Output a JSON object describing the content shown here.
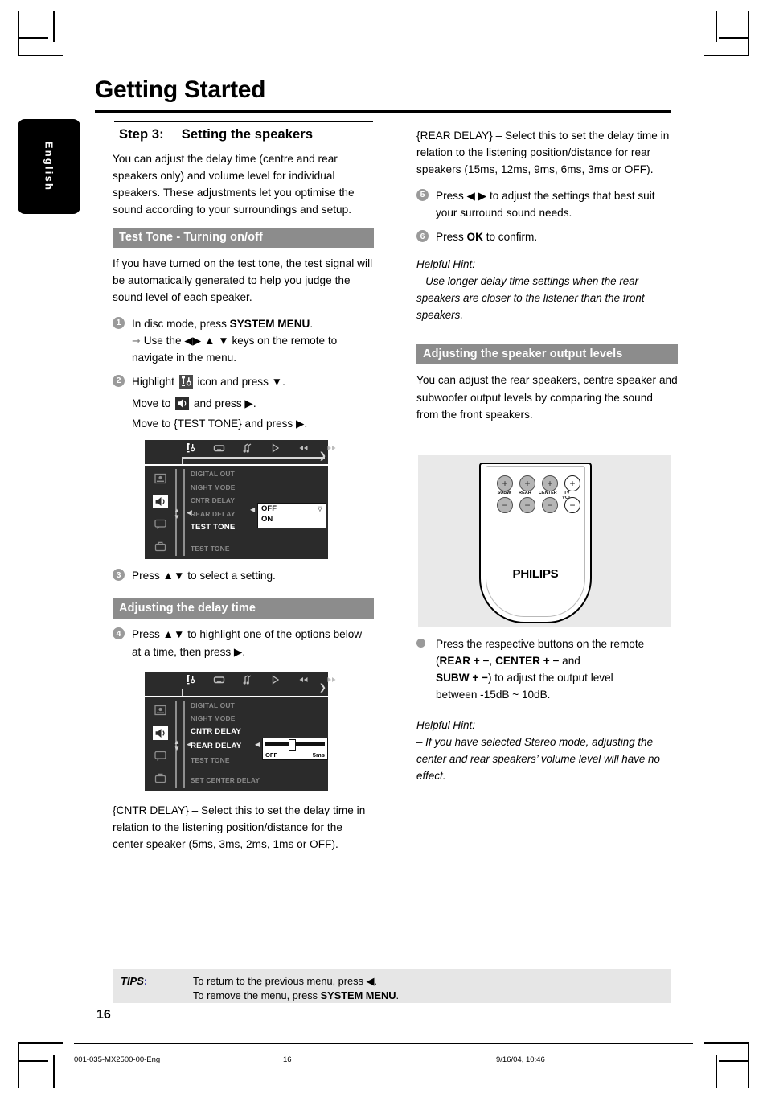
{
  "document": {
    "title": "Getting Started",
    "language_tab": "English",
    "page_number": "16"
  },
  "left_column": {
    "step_heading": {
      "prefix": "Step 3:",
      "text": "Setting the speakers"
    },
    "intro": "You can adjust the delay time (centre and rear speakers only) and volume level for individual speakers. These adjustments let you optimise the sound according to your surroundings and setup.",
    "section_test_tone": {
      "bar_label": "Test Tone - Turning on/off",
      "paragraph": "If you have turned on the test tone, the test signal will be automatically generated to help you judge the sound level of each speaker.",
      "steps": [
        {
          "number": "1",
          "line1_pre": "In disc mode, press ",
          "line1_bold": "SYSTEM MENU",
          "line1_post": ".",
          "arrow_line": "Use the ◀▶ ▲ ▼ keys on the remote to navigate in the menu."
        },
        {
          "number": "2",
          "line_a_pre": "Highlight ",
          "line_a_post": " icon and press ▼.",
          "line_b_pre": "Move to ",
          "line_b_post": " and press ▶.",
          "line_c": "Move to {TEST TONE} and press ▶."
        },
        {
          "number": "3",
          "text": "Press ▲▼ to select a setting."
        }
      ]
    },
    "osd_test_tone": {
      "top_icons": [
        "tools-icon",
        "display-icon",
        "audio-icon",
        "play-icon",
        "rewind-icon",
        "forward-icon"
      ],
      "side_icons": [
        "picture-icon",
        "speaker-icon",
        "subtitle-icon",
        "briefcase-icon"
      ],
      "menu_items": [
        "DIGITAL OUT",
        "NIGHT MODE",
        "CNTR DELAY",
        "REAR DELAY",
        "TEST TONE"
      ],
      "active_item": "TEST TONE",
      "footer_hint": "TEST TONE",
      "dropdown_options": [
        "OFF",
        "ON"
      ]
    },
    "section_delay": {
      "bar_label": "Adjusting the delay time",
      "step": {
        "number": "4",
        "text": "Press ▲▼ to highlight one of the options below at a time, then press ▶."
      }
    },
    "osd_delay": {
      "top_icons": [
        "tools-icon",
        "display-icon",
        "audio-icon",
        "play-icon",
        "rewind-icon",
        "forward-icon"
      ],
      "side_icons": [
        "picture-icon",
        "speaker-icon",
        "subtitle-icon",
        "briefcase-icon"
      ],
      "menu_items": [
        "DIGITAL OUT",
        "NIGHT MODE",
        "CNTR DELAY",
        "REAR DELAY",
        "TEST TONE"
      ],
      "active_items": [
        "CNTR DELAY",
        "REAR DELAY"
      ],
      "footer_hint": "SET CENTER DELAY",
      "slider_min_label": "OFF",
      "slider_max_label": "5ms"
    },
    "cntr_delay_desc": "{CNTR DELAY} – Select this to set the delay time in relation to the listening position/distance for the center speaker (5ms, 3ms, 2ms, 1ms or OFF)."
  },
  "right_column": {
    "rear_delay_desc": "{REAR DELAY} – Select this to set the delay time in relation to the listening position/distance for rear speakers (15ms, 12ms, 9ms, 6ms, 3ms or OFF).",
    "steps": [
      {
        "number": "5",
        "text": "Press ◀ ▶  to adjust the settings that best suit your surround sound needs."
      },
      {
        "number": "6",
        "pre": "Press ",
        "bold": "OK",
        "post": " to confirm."
      }
    ],
    "hint1": {
      "title": "Helpful Hint:",
      "text": "–  Use longer delay time settings when the rear speakers are closer to the listener than the front speakers."
    },
    "section_output": {
      "bar_label": "Adjusting the speaker output levels",
      "paragraph": "You can adjust the rear speakers, centre speaker and subwoofer output levels by comparing the sound from the front speakers."
    },
    "remote": {
      "brand": "PHILIPS",
      "buttons": [
        {
          "label": "SUBW",
          "plus": "+",
          "minus": "−",
          "style": "grey"
        },
        {
          "label": "REAR",
          "plus": "+",
          "minus": "−",
          "style": "grey"
        },
        {
          "label": "CENTER",
          "plus": "+",
          "minus": "−",
          "style": "grey"
        },
        {
          "label": "TV VOL",
          "plus": "+",
          "minus": "−",
          "style": "white"
        }
      ]
    },
    "bullet": {
      "l1": "Press the respective buttons on the remote",
      "l2_b1": "REAR",
      "l2_sym1": "+ −",
      "l2_mid": ", ",
      "l2_b2": "CENTER",
      "l2_sym2": "+ −",
      "l2_end": " and",
      "l3_b3": "SUBW",
      "l3_sym3": "+ −",
      "l3_end": ") to adjust the output level",
      "l4": "between -15dB ~ 10dB."
    },
    "hint2": {
      "title": "Helpful Hint:",
      "text": "–  If you have selected Stereo mode, adjusting the center and rear speakers’ volume level will have no effect."
    }
  },
  "tips": {
    "label": "TIPS",
    "colon": ":",
    "line1_pre": "To return to the previous menu, press ◀",
    "line1_post": ".",
    "line2_pre": "To remove the menu, press ",
    "line2_bold": "SYSTEM MENU",
    "line2_post": "."
  },
  "footer": {
    "file": "001-035-MX2500-00-Eng",
    "page": "16",
    "timestamp": "9/16/04, 10:46"
  },
  "colors": {
    "section_bar": "#8c8c8c",
    "tips_bg": "#e6e6e6",
    "osd_bg": "#2b2b2b",
    "step_bullet": "#9a9a9a"
  }
}
